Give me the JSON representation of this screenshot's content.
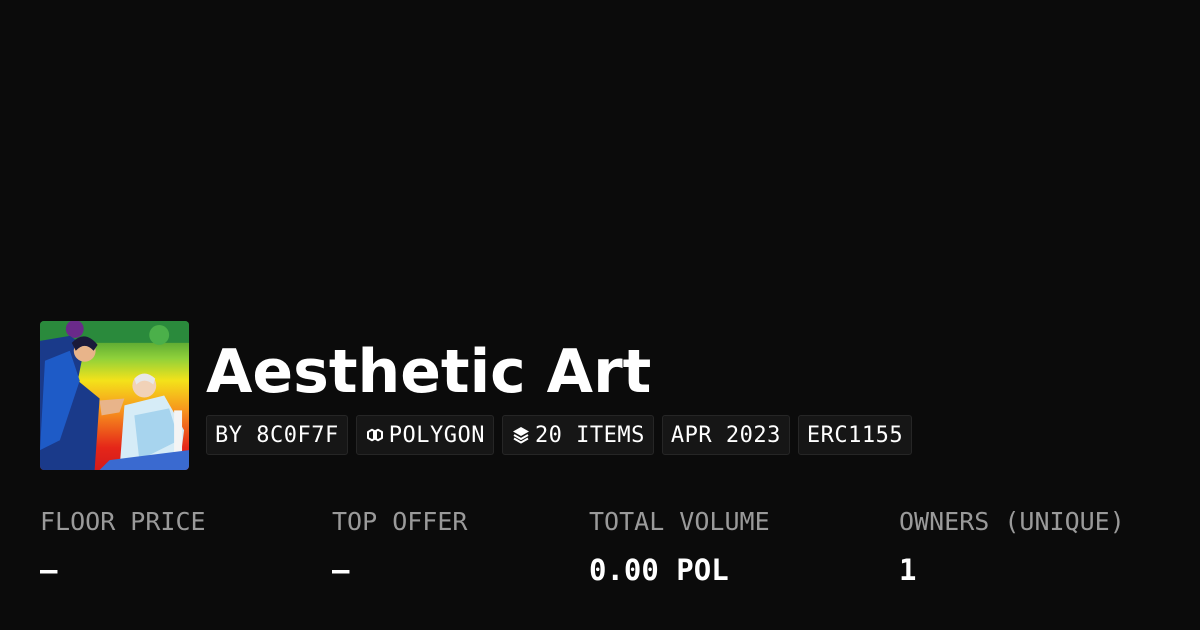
{
  "collection": {
    "title": "Aesthetic Art",
    "thumbnail_description_icon": "collection-artwork"
  },
  "badges": {
    "creator": "BY 8C0F7F",
    "chain": "POLYGON",
    "chain_icon": "polygon-icon",
    "items": "20 ITEMS",
    "items_icon": "layers-icon",
    "date": "APR 2023",
    "standard": "ERC1155"
  },
  "stats": {
    "floor_price": {
      "label": "FLOOR PRICE",
      "value": "–"
    },
    "top_offer": {
      "label": "TOP OFFER",
      "value": "–"
    },
    "total_volume": {
      "label": "TOTAL VOLUME",
      "value": "0.00 POL"
    },
    "owners": {
      "label": "OWNERS (UNIQUE)",
      "value": "1"
    }
  },
  "colors": {
    "background": "#0b0b0b",
    "badge_background": "#161616",
    "label_gray": "#9a9a9a",
    "text": "#ffffff"
  }
}
